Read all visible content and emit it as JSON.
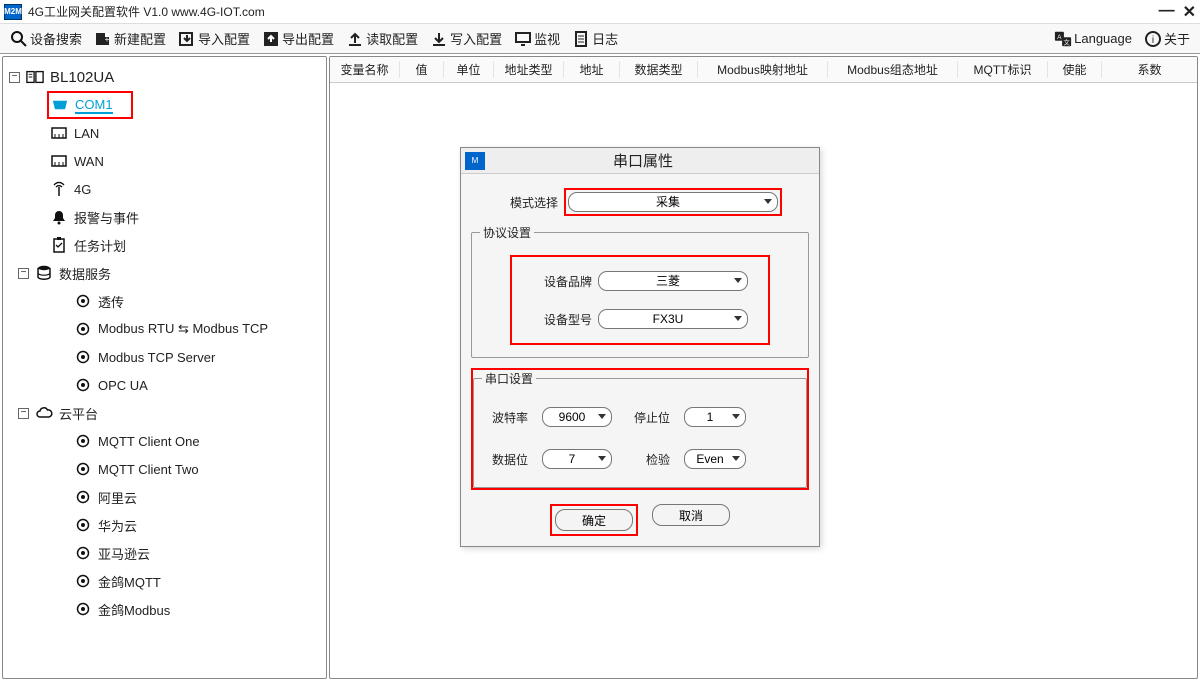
{
  "titlebar": {
    "app_icon_text": "M2M",
    "title": "4G工业网关配置软件 V1.0 www.4G-IOT.com"
  },
  "toolbar": {
    "search": "设备搜索",
    "new": "新建配置",
    "import": "导入配置",
    "export": "导出配置",
    "read": "读取配置",
    "write": "写入配置",
    "monitor": "监视",
    "log": "日志",
    "language": "Language",
    "about": "关于"
  },
  "tree": {
    "root": "BL102UA",
    "com1": "COM1",
    "lan": "LAN",
    "wan": "WAN",
    "fourg": "4G",
    "alarm": "报警与事件",
    "task": "任务计划",
    "data_service": "数据服务",
    "ds_passthrough": "透传",
    "ds_mrtu": "Modbus RTU ⇆ Modbus TCP",
    "ds_mtcp": "Modbus TCP Server",
    "ds_opc": "OPC UA",
    "cloud": "云平台",
    "cloud_mqtt1": "MQTT Client One",
    "cloud_mqtt2": "MQTT Client Two",
    "cloud_ali": "阿里云",
    "cloud_huawei": "华为云",
    "cloud_aws": "亚马逊云",
    "cloud_kingmqtt": "金鸽MQTT",
    "cloud_kingmodbus": "金鸽Modbus"
  },
  "table": {
    "h_varname": "变量名称",
    "h_value": "值",
    "h_unit": "单位",
    "h_addrtype": "地址类型",
    "h_addr": "地址",
    "h_datatype": "数据类型",
    "h_modbusmap": "Modbus映射地址",
    "h_modbusgroup": "Modbus组态地址",
    "h_mqtt": "MQTT标识",
    "h_enable": "使能",
    "h_coef": "系数"
  },
  "dialog": {
    "title": "串口属性",
    "mode_label": "模式选择",
    "mode_value": "采集",
    "protocol_legend": "协议设置",
    "brand_label": "设备品牌",
    "brand_value": "三菱",
    "model_label": "设备型号",
    "model_value": "FX3U",
    "serial_legend": "串口设置",
    "baud_label": "波特率",
    "baud_value": "9600",
    "stop_label": "停止位",
    "stop_value": "1",
    "databits_label": "数据位",
    "databits_value": "7",
    "parity_label": "检验",
    "parity_value": "Even",
    "ok": "确定",
    "cancel": "取消"
  }
}
